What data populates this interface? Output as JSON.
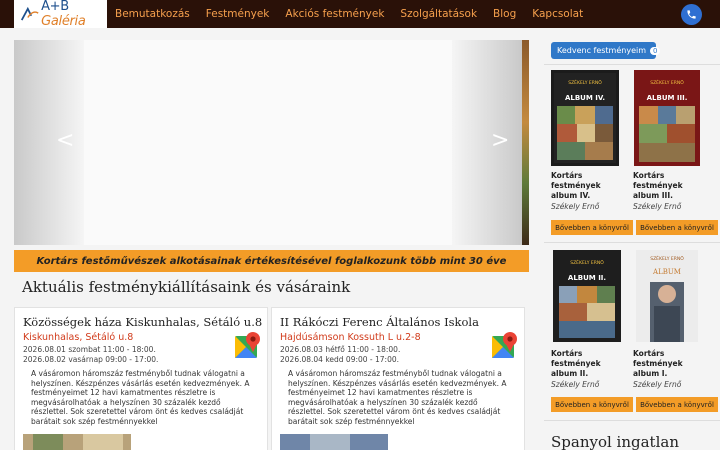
{
  "brand": {
    "logo_text": "A+B Galéria",
    "logo_prefix": "A+B ",
    "logo_suffix": "Galéria"
  },
  "nav": {
    "items": [
      {
        "label": "Bemutatkozás"
      },
      {
        "label": "Festmények"
      },
      {
        "label": "Akciós festmények"
      },
      {
        "label": "Szolgáltatások"
      },
      {
        "label": "Blog"
      },
      {
        "label": "Kapcsolat"
      }
    ],
    "phone_icon": "phone-icon"
  },
  "carousel": {
    "prev_label": "<",
    "next_label": ">"
  },
  "banner": {
    "text": "Kortárs festőművészek alkotásainak értékesítésével foglalkozunk több mint 30 éve"
  },
  "exhibitions": {
    "heading": "Aktuális festménykiállításaink és vásáraink",
    "cards": [
      {
        "title": "Közösségek háza Kiskunhalas, Sétáló u.8",
        "location": "Kiskunhalas, Sétáló u.8",
        "date_1": "2026.08.01 szombat 11:00 - 18:00.",
        "date_2": "2026.08.02 vasárnap 09:00 - 17:00.",
        "description": "A vásáromon háromszáz festményből tudnak válogatni a helyszínen. Készpénzes vásárlás esetén kedvezmények. A festményeimet 12 havi kamatmentes részletre is megvásárolhatóak a helyszínen 30 százalék kezdő részlettel. Sok szeretettel várom önt és kedves családját barátait sok szép festménnyekkel"
      },
      {
        "title": "II Rákóczi Ferenc Általános Iskola",
        "location": "Hajdúsámson Kossuth L u.2-8",
        "date_1": "2026.08.03 hétfő 11:00 - 18:00.",
        "date_2": "2026.08.04 kedd 09:00 - 17:00.",
        "description": "A vásáromon háromszáz festményből tudnak válogatni a helyszínen. Készpénzes vásárlás esetén kedvezmények. A festményeimet 12 havi kamatmentes részletre is megvásárolhatóak a helyszínen 30 százalék kezdő részlettel. Sok szeretettel várom önt és kedves családját barátait sok szép festménnyekkel"
      }
    ]
  },
  "sidebar": {
    "favorites_label": "Kedvenc festményeim",
    "favorites_count": "0",
    "more_label": "Bővebben a könyvről",
    "books": [
      {
        "title": "Kortárs festmények album IV.",
        "author": "Székely Ernő",
        "cover_text": "ALBUM IV."
      },
      {
        "title": "Kortárs festmények album III.",
        "author": "Székely Ernő",
        "cover_text": "ALBUM III."
      },
      {
        "title": "Kortárs festmények album II.",
        "author": "Székely Ernő",
        "cover_text": "ALBUM II."
      },
      {
        "title": "Kortárs festmények album I.",
        "author": "Székely Ernő",
        "cover_text": "ALBUM"
      }
    ],
    "cover_author": "SZÉKELY ERNŐ",
    "next_heading": "Spanyol ingatlan"
  },
  "colors": {
    "nav_bg": "#2a1108",
    "nav_link": "#f6a04d",
    "accent_orange": "#f39c27",
    "accent_blue": "#2f78c8",
    "location_red": "#d13b1b"
  }
}
